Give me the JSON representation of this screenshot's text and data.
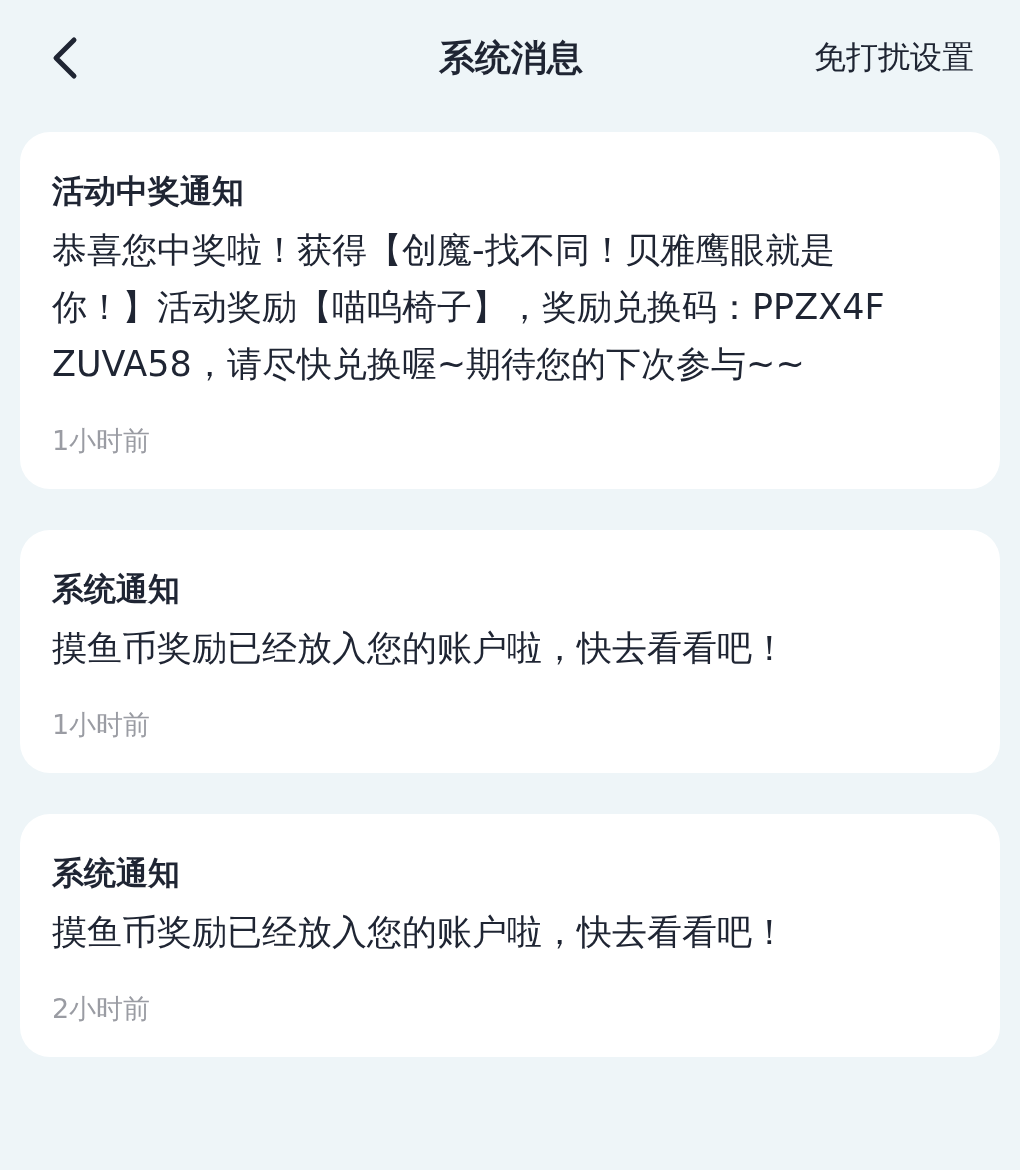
{
  "header": {
    "title": "系统消息",
    "action": "免打扰设置"
  },
  "messages": [
    {
      "title": "活动中奖通知",
      "body": "恭喜您中奖啦！获得【创魔-找不同！贝雅鹰眼就是你！】活动奖励【喵呜椅子】，奖励兑换码：PPZX4FZUVA58，请尽快兑换喔~期待您的下次参与~~",
      "time": "1小时前"
    },
    {
      "title": "系统通知",
      "body": "摸鱼币奖励已经放入您的账户啦，快去看看吧！",
      "time": "1小时前"
    },
    {
      "title": "系统通知",
      "body": "摸鱼币奖励已经放入您的账户啦，快去看看吧！",
      "time": "2小时前"
    }
  ]
}
